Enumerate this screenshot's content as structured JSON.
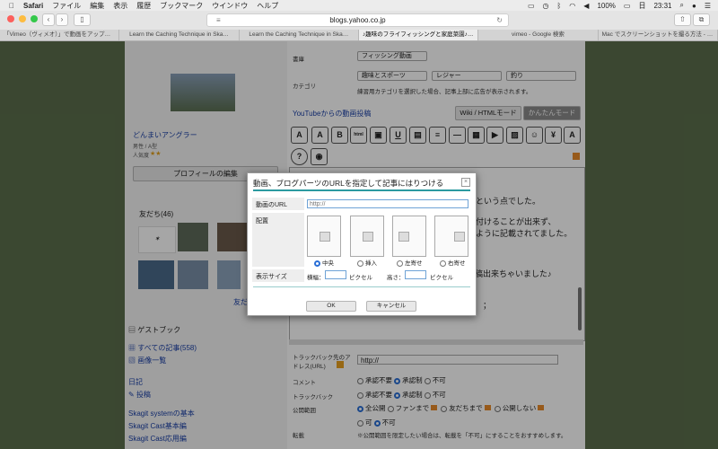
{
  "menubar": {
    "apple": "",
    "app": "Safari",
    "items": [
      "ファイル",
      "編集",
      "表示",
      "履歴",
      "ブックマーク",
      "ウインドウ",
      "ヘルプ"
    ],
    "battery": "100%",
    "day": "日",
    "time": "23:31"
  },
  "browser": {
    "url": "blogs.yahoo.co.jp",
    "tabs": [
      {
        "title": "「Vimeo（ヴィメオ）」で動画をアップロー…"
      },
      {
        "title": "Learn the Caching Technique in Ska…"
      },
      {
        "title": "Learn the Caching Technique in Ska…"
      },
      {
        "title": "♪趣味のフライフィッシングと家庭菜園♪ -…"
      },
      {
        "title": "vimeo - Google 検索"
      },
      {
        "title": "Mac でスクリーンショットを撮る方法 - A…"
      }
    ]
  },
  "sidebar": {
    "profile_name": "どんまいアングラー",
    "profile_meta": "男性 / A型",
    "popularity_label": "人気度",
    "profile_edit_button": "プロフィールの編集",
    "friends_title": "友だち(46)",
    "friends_more": "友だ",
    "guestbook": "ゲストブック",
    "all_articles": "すべての記事(558)",
    "images_list": "画像一覧",
    "diary": "日記",
    "post": "投稿",
    "skagit_links": [
      "Skagit systemの基本",
      "Skagit Cast基本編",
      "Skagit Cast応用編"
    ]
  },
  "editor": {
    "category_label": "書庫",
    "category_value": "フィッシング動画",
    "category2_label": "カテゴリ",
    "select_hobby": "趣味とスポーツ",
    "select_leisure": "レジャー",
    "select_fishing": "釣り",
    "category_note": "練習用カテゴリを選択した場合、記事上部に広告が表示されます。",
    "youtube_link": "YouTubeからの動画投稿",
    "wiki_mode": "Wiki / HTMLモード",
    "easy_mode": "かんたんモード",
    "body_lines": [
      "という点でした。",
      "付けることが出来ず、",
      "ように記載されてました。",
      "投稿出来ちゃいました♪",
      "；"
    ]
  },
  "lower_form": {
    "trackback_url_label": "トラックバック先のアドレス(URL)",
    "trackback_url_value": "http://",
    "comment_label": "コメント",
    "trackback_label": "トラックバック",
    "opt_not_needed": "承認不要",
    "opt_approval": "承認制",
    "opt_disallow": "不可",
    "visibility_label": "公開範囲",
    "vis_all": "全公開",
    "vis_fans": "ファンまで",
    "vis_friends": "友だちまで",
    "vis_private": "公開しない",
    "reprint_label": "転載",
    "reprint_allow": "可",
    "reprint_deny": "不可",
    "reprint_note": "※公開範囲を限定したい場合は、転載を「不可」にすることをおすすめします。"
  },
  "dialog": {
    "title": "動画、ブログパーツのURLを指定して記事にはりつける",
    "url_label": "動画のURL",
    "url_placeholder": "http://",
    "layout_label": "配置",
    "layout_options": [
      "中央",
      "挿入",
      "左寄せ",
      "右寄せ"
    ],
    "size_label": "表示サイズ",
    "width_label": "横幅：",
    "height_label": "高さ：",
    "unit": "ピクセル",
    "ok": "OK",
    "cancel": "キャンセル"
  },
  "colors": {
    "accent": "#2a6fd6",
    "link": "#1a3fa6"
  }
}
